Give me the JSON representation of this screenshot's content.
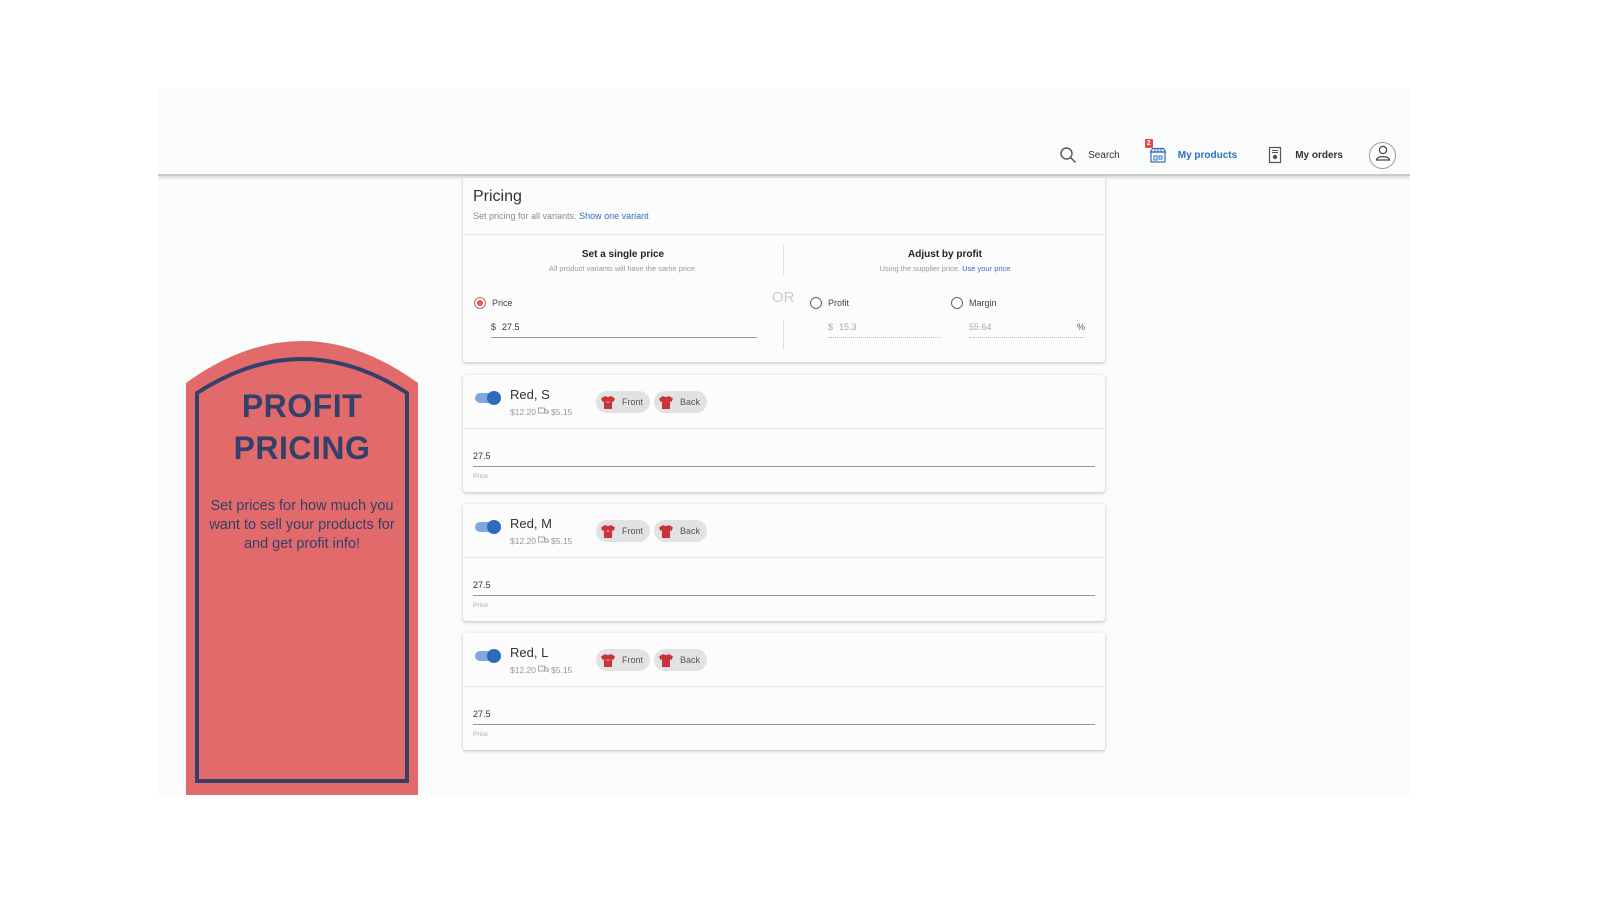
{
  "header": {
    "nav": [
      {
        "label": "Search",
        "icon": "search-icon"
      },
      {
        "label": "My products",
        "icon": "store-icon",
        "badge": "2",
        "active": true
      },
      {
        "label": "My orders",
        "icon": "receipt-icon"
      }
    ],
    "avatar_icon": "user-icon"
  },
  "colors": {
    "accent_blue": "#2f6fbf",
    "radio_red": "#e55a5a",
    "promo_bg": "#e26a6a",
    "promo_ink": "#33406a",
    "shirt_red": "#c8343a"
  },
  "pricing": {
    "title": "Pricing",
    "subtitle": "Set pricing for all variants.",
    "subtitle_link": "Show one variant",
    "single": {
      "title": "Set a single price",
      "subtitle": "All product variants will have the same price.",
      "radio_label": "Price",
      "selected": true,
      "currency": "$",
      "value": "27.5"
    },
    "or_label": "OR",
    "profit": {
      "title": "Adjust by profit",
      "subtitle": "Using the supplier price.",
      "subtitle_link": "Use your price",
      "profit_label": "Profit",
      "profit_currency": "$",
      "profit_value": "15.3",
      "margin_label": "Margin",
      "margin_value": "55.64",
      "margin_unit": "%"
    }
  },
  "variants": [
    {
      "name": "Red, S",
      "cost": "$12.20",
      "shipping": "$5.15",
      "enabled": true,
      "chips": [
        "Front",
        "Back"
      ],
      "price": "27.5",
      "price_label": "Price"
    },
    {
      "name": "Red, M",
      "cost": "$12.20",
      "shipping": "$5.15",
      "enabled": true,
      "chips": [
        "Front",
        "Back"
      ],
      "price": "27.5",
      "price_label": "Price"
    },
    {
      "name": "Red, L",
      "cost": "$12.20",
      "shipping": "$5.15",
      "enabled": true,
      "chips": [
        "Front",
        "Back"
      ],
      "price": "27.5",
      "price_label": "Price"
    }
  ],
  "promo": {
    "title_line1": "PROFIT",
    "title_line2": "PRICING",
    "text": "Set prices for how much you want to sell your products for and get profit info!"
  }
}
